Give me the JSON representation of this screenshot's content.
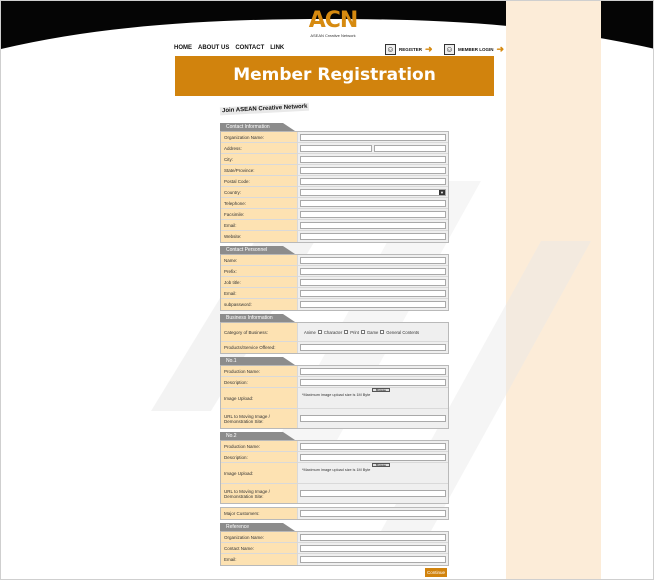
{
  "logo": {
    "text": "ACN",
    "sub": "ASEAN Creative Network"
  },
  "nav": [
    "HOME",
    "ABOUT US",
    "CONTACT",
    "LINK"
  ],
  "top_buttons": {
    "register": "REGISTER",
    "member_login": "MEMBER LOGIN"
  },
  "banner": "Member Registration",
  "join_label": "Join ASEAN Creative Network",
  "sections": {
    "contact_info": {
      "title": "Contact Information",
      "fields": [
        "Organization Name:",
        "Address:",
        "City:",
        "State/Province:",
        "Postal Code:",
        "Country:",
        "Telephone:",
        "Facsimile:",
        "Email:",
        "Website:"
      ]
    },
    "contact_person": {
      "title": "Contact Personnel",
      "fields": [
        "Name:",
        "Prefix:",
        "Job title:",
        "Email:",
        "subpassword:"
      ]
    },
    "business_info": {
      "title": "Business Information",
      "category_label": "Category of Business:",
      "categories": [
        "Anime",
        "Character",
        "Print",
        "Game",
        "General Contents"
      ],
      "products_label": "Products/Service Offered:"
    },
    "no1": {
      "title": "No.1",
      "production": "Production Name:",
      "description": "Description:",
      "image_upload": "Image Upload:",
      "browse": "Browse",
      "note": "*Maximum image upload size is 1M Byte",
      "url": "URL to Moving Image / Demonstration Site:"
    },
    "no2": {
      "title": "No.2",
      "production": "Production Name:",
      "description": "Description:",
      "image_upload": "Image Upload:",
      "browse": "Browse",
      "note": "*Maximum image upload size is 1M Byte",
      "url": "URL to Moving Image / Demonstration Site:",
      "major_customers": "Major Customers:"
    },
    "reference": {
      "title": "Reference",
      "fields": [
        "Organization Name:",
        "Contact Name:",
        "Email:"
      ]
    }
  },
  "continue_label": "Continue",
  "colors": {
    "accent": "#d1830d",
    "label_bg": "#fde2b2",
    "cream": "#fcecd8",
    "header": "#000000"
  }
}
